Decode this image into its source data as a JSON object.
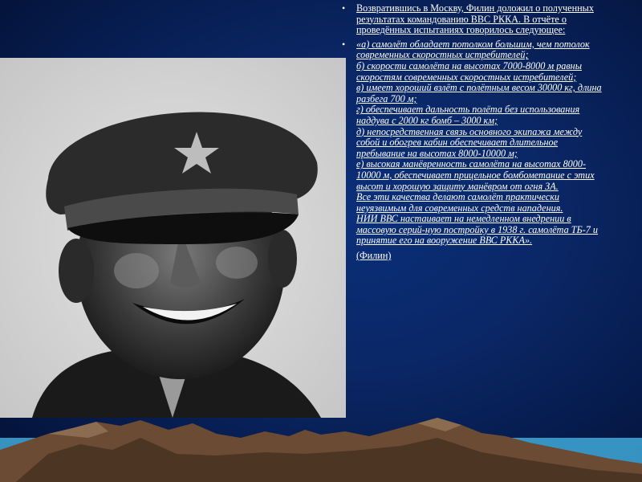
{
  "bullets": [
    {
      "text": "Возвратившись в Москву, Филин доложил о полученных результатах командованию ВВС РККА. В отчёте о проведённых испытаниях говорилось следующее:"
    },
    {
      "lines": [
        "«а) самолёт обладает потолком большим, чем потолок современных скоростных истребителей;",
        "б) скорости самолёта на высотах 7000-8000 м равны скоростям современных скоростных истребителей;",
        "в) имеет хороший взлёт с полётным весом 30000 кг, длина разбега 700 м;",
        "г) обеспечивает дальность полёта без использования наддува с 2000 кг бомб – 3000 км;",
        "д) непосредственная связь основного экипажа между собой и обогрев кабин обеспечивает длительное пребывание на высотах 8000-10000 м;",
        "е) высокая манёвренность самолёта на высотах 8000-10000 м, обеспечивает прицельное бомбометание с этих высот и хорошую защиту манёвром от огня ЗА.",
        "Все эти качества делают самолёт практически неуязвимым для современных средств нападения.",
        "НИИ ВВС настаивает на немедленном внедрении в массовую серий-ную постройку в 1938 г. самолёта ТБ-7 и принятие его на вооружение ВВС РККА»."
      ],
      "signature": "(Филин)"
    }
  ],
  "bullet_glyph": "•",
  "colors": {
    "background": "#0a2766",
    "text": "#ffffff",
    "mountain_dark": "#5a3f2a",
    "mountain_light": "#8a6a4e",
    "mountain_sky": "#3fa9d8"
  }
}
